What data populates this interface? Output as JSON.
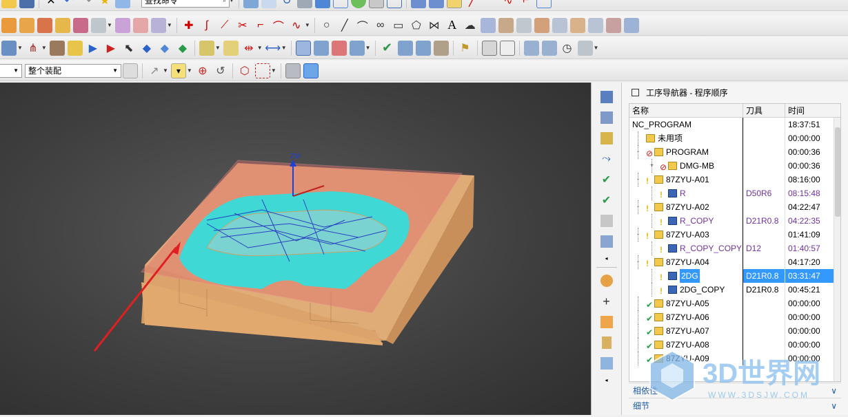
{
  "toolbar": {
    "find_command_placeholder": "查找命令",
    "assembly_filter_value": "整个装配"
  },
  "navigator": {
    "title": "工序导航器 - 程序顺序",
    "columns": {
      "name": "名称",
      "tool": "刀具",
      "time": "时间"
    },
    "rows": [
      {
        "name": "NC_PROGRAM",
        "tool": "",
        "time": "18:37:51",
        "level": 0,
        "expander": "",
        "status": "",
        "type": "root"
      },
      {
        "name": "未用项",
        "tool": "",
        "time": "00:00:00",
        "level": 1,
        "expander": "",
        "status": "",
        "type": "group"
      },
      {
        "name": "PROGRAM",
        "tool": "",
        "time": "00:00:36",
        "level": 1,
        "expander": "-",
        "status": "blocked",
        "type": "group"
      },
      {
        "name": "DMG-MB",
        "tool": "",
        "time": "00:00:36",
        "level": 2,
        "expander": "+",
        "status": "blocked",
        "type": "group"
      },
      {
        "name": "87ZYU-A01",
        "tool": "",
        "time": "08:16:00",
        "level": 1,
        "expander": "-",
        "status": "pending",
        "type": "group"
      },
      {
        "name": "R",
        "tool": "D50R6",
        "time": "08:15:48",
        "level": 2,
        "expander": "",
        "status": "pending",
        "type": "op",
        "purple": true
      },
      {
        "name": "87ZYU-A02",
        "tool": "",
        "time": "04:22:47",
        "level": 1,
        "expander": "-",
        "status": "pending",
        "type": "group"
      },
      {
        "name": "R_COPY",
        "tool": "D21R0.8",
        "time": "04:22:35",
        "level": 2,
        "expander": "",
        "status": "pending",
        "type": "op",
        "purple": true
      },
      {
        "name": "87ZYU-A03",
        "tool": "",
        "time": "01:41:09",
        "level": 1,
        "expander": "-",
        "status": "pending",
        "type": "group"
      },
      {
        "name": "R_COPY_COPY",
        "tool": "D12",
        "time": "01:40:57",
        "level": 2,
        "expander": "",
        "status": "pending",
        "type": "op",
        "purple": true
      },
      {
        "name": "87ZYU-A04",
        "tool": "",
        "time": "04:17:20",
        "level": 1,
        "expander": "-",
        "status": "pending",
        "type": "group"
      },
      {
        "name": "2DG",
        "tool": "D21R0.8",
        "time": "03:31:47",
        "level": 2,
        "expander": "",
        "status": "pending",
        "type": "op",
        "selected": true
      },
      {
        "name": "2DG_COPY",
        "tool": "D21R0.8",
        "time": "00:45:21",
        "level": 2,
        "expander": "",
        "status": "pending",
        "type": "op"
      },
      {
        "name": "87ZYU-A05",
        "tool": "",
        "time": "00:00:00",
        "level": 1,
        "expander": "",
        "status": "done",
        "type": "group"
      },
      {
        "name": "87ZYU-A06",
        "tool": "",
        "time": "00:00:00",
        "level": 1,
        "expander": "",
        "status": "done",
        "type": "group"
      },
      {
        "name": "87ZYU-A07",
        "tool": "",
        "time": "00:00:00",
        "level": 1,
        "expander": "",
        "status": "done",
        "type": "group"
      },
      {
        "name": "87ZYU-A08",
        "tool": "",
        "time": "00:00:00",
        "level": 1,
        "expander": "",
        "status": "done",
        "type": "group"
      },
      {
        "name": "87ZYU-A09",
        "tool": "",
        "time": "00:00:00",
        "level": 1,
        "expander": "",
        "status": "done",
        "type": "group"
      }
    ],
    "footer": {
      "dependencies": "相依性",
      "details": "细节"
    }
  },
  "viewport": {
    "axis_label": "ZM"
  },
  "watermark": {
    "brand": "3D世界网",
    "url": "WWW.3DSJW.COM"
  },
  "colors": {
    "selection": "#3399ff",
    "operation_text": "#7030a0",
    "part_fill": "#e8b27a",
    "toolpath": "#2fe0e0",
    "blank": "#e07070"
  }
}
